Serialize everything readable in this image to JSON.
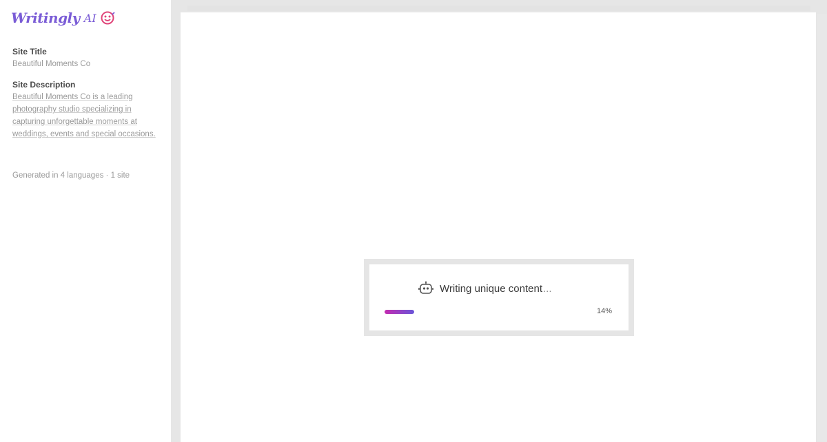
{
  "brand": {
    "name": "Writingly",
    "suffix": "AI"
  },
  "sidebar": {
    "site_title_label": "Site Title",
    "site_title_value": "Beautiful Moments Co",
    "site_description_label": "Site Description",
    "site_description_value": "Beautiful Moments Co is a leading photography studio specializing in capturing unforgettable moments at weddings, events and special occasions.",
    "generated_info": "Generated in 4 languages · 1 site"
  },
  "progress": {
    "title": "Writing unique content",
    "dots": "...",
    "percent_label": "14%",
    "value": 0.14
  },
  "colors": {
    "brand": "#7a5cd6",
    "progress_start": "#c32bb0",
    "progress_end": "#6a55d8"
  },
  "icons": {
    "logo": "smiley-face-icon",
    "loader": "robot-icon"
  }
}
